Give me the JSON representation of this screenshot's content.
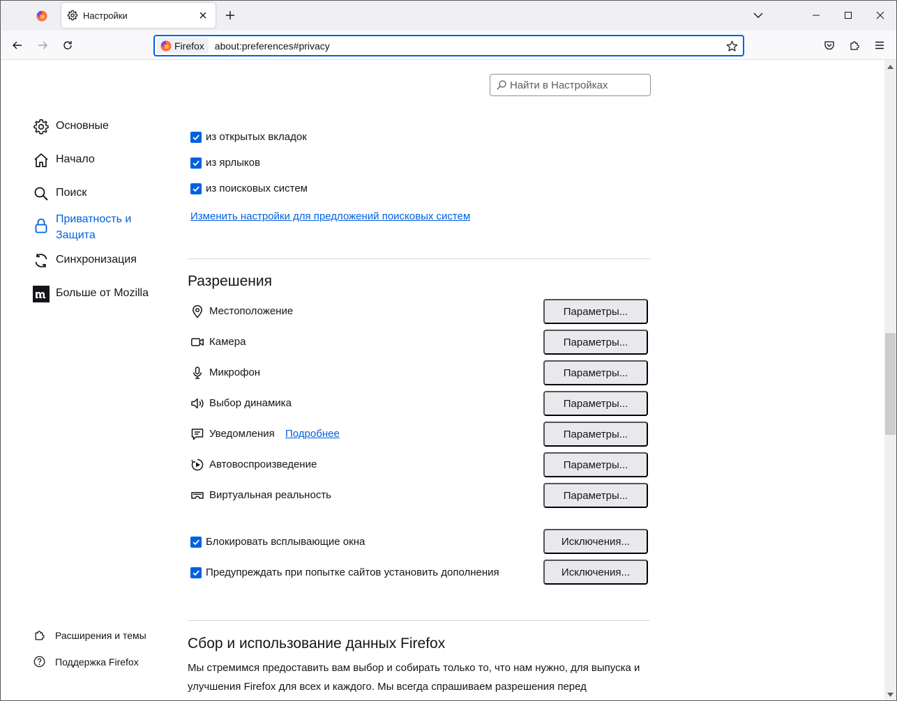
{
  "tabbar": {
    "tab_title": "Настройки"
  },
  "navbar": {
    "identity_label": "Firefox",
    "url": "about:preferences#privacy"
  },
  "search": {
    "placeholder": "Найти в Настройках"
  },
  "sidebar": {
    "categories": [
      {
        "label": "Основные",
        "icon": "gear-icon"
      },
      {
        "label": "Начало",
        "icon": "home-icon"
      },
      {
        "label": "Поиск",
        "icon": "search-icon"
      },
      {
        "label": "Приватность и Защита",
        "icon": "lock-icon",
        "selected": true
      },
      {
        "label": "Синхронизация",
        "icon": "sync-icon"
      },
      {
        "label": "Больше от Mozilla",
        "icon": "mozilla-icon"
      }
    ],
    "footer": [
      {
        "label": "Расширения и темы",
        "icon": "puzzle-icon"
      },
      {
        "label": "Поддержка Firefox",
        "icon": "help-icon"
      }
    ]
  },
  "suggestions": {
    "checkboxes": [
      {
        "label": "из открытых вкладок",
        "checked": true
      },
      {
        "label": "из ярлыков",
        "checked": true
      },
      {
        "label": "из поисковых систем",
        "checked": true
      }
    ],
    "link": "Изменить настройки для предложений поисковых систем"
  },
  "permissions": {
    "heading": "Разрешения",
    "button_label": "Параметры...",
    "learn_more": "Подробнее",
    "items": [
      {
        "label": "Местоположение",
        "icon": "location-icon"
      },
      {
        "label": "Камера",
        "icon": "camera-icon"
      },
      {
        "label": "Микрофон",
        "icon": "microphone-icon"
      },
      {
        "label": "Выбор динамика",
        "icon": "speaker-icon"
      },
      {
        "label": "Уведомления",
        "icon": "notification-icon"
      },
      {
        "label": "Автовоспроизведение",
        "icon": "autoplay-icon"
      },
      {
        "label": "Виртуальная реальность",
        "icon": "vr-icon"
      }
    ],
    "extra": [
      {
        "label": "Блокировать всплывающие окна",
        "checked": true,
        "button": "Исключения..."
      },
      {
        "label": "Предупреждать при попытке сайтов установить дополнения",
        "checked": true,
        "button": "Исключения..."
      }
    ]
  },
  "data_collection": {
    "heading": "Сбор и использование данных Firefox",
    "line1": "Мы стремимся предоставить вам выбор и собирать только то, что нам нужно, для выпуска и",
    "line2": "улучшения Firefox для всех и каждого. Мы всегда спрашиваем разрешения перед"
  },
  "colors": {
    "accent": "#0061e0",
    "button_bg": "#e9e9ed",
    "toolbar_bg": "#f9f9fb",
    "tabbar_bg": "#f0f0f4"
  }
}
